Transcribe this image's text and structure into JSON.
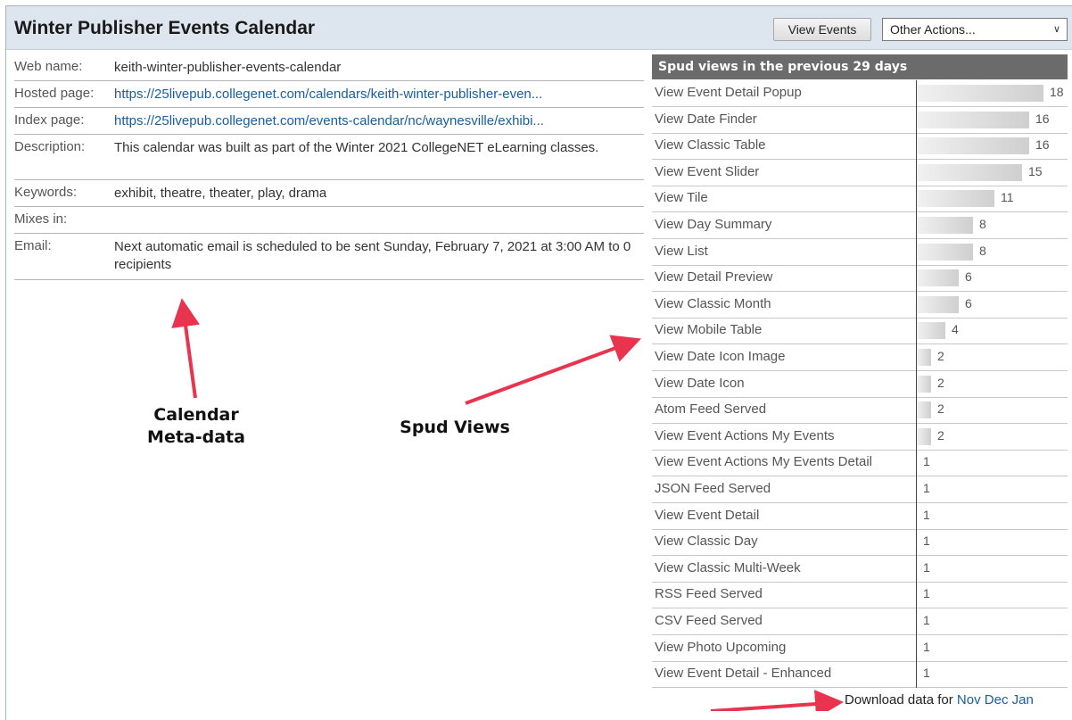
{
  "header": {
    "title": "Winter Publisher Events Calendar",
    "view_events_label": "View Events",
    "other_actions_label": "Other Actions..."
  },
  "meta": {
    "web_name": {
      "label": "Web name:",
      "value": "keith-winter-publisher-events-calendar"
    },
    "hosted_page": {
      "label": "Hosted page:",
      "value": "https://25livepub.collegenet.com/calendars/keith-winter-publisher-even..."
    },
    "index_page": {
      "label": "Index page:",
      "value": "https://25livepub.collegenet.com/events-calendar/nc/waynesville/exhibi..."
    },
    "description": {
      "label": "Description:",
      "value": "This calendar was built as part of the Winter 2021 CollegeNET eLearning classes."
    },
    "keywords": {
      "label": "Keywords:",
      "value": "exhibit, theatre, theater, play, drama"
    },
    "mixes_in": {
      "label": "Mixes in:",
      "value": ""
    },
    "email": {
      "label": "Email:",
      "value": "Next automatic email is scheduled to be sent Sunday, February 7, 2021 at 3:00 AM to 0 recipients"
    }
  },
  "stats": {
    "title": "Spud views in the previous 29 days",
    "max": 18,
    "rows": [
      {
        "label": "View Event Detail Popup",
        "value": "18",
        "count": 18
      },
      {
        "label": "View Date Finder",
        "value": "16",
        "count": 16
      },
      {
        "label": "View Classic Table",
        "value": "16",
        "count": 16
      },
      {
        "label": "View Event Slider",
        "value": "15",
        "count": 15
      },
      {
        "label": "View Tile",
        "value": "11",
        "count": 11
      },
      {
        "label": "View Day Summary",
        "value": "8",
        "count": 8
      },
      {
        "label": "View List",
        "value": "8",
        "count": 8
      },
      {
        "label": "View Detail Preview",
        "value": "6",
        "count": 6
      },
      {
        "label": "View Classic Month",
        "value": "6",
        "count": 6
      },
      {
        "label": "View Mobile Table",
        "value": "4",
        "count": 4
      },
      {
        "label": "View Date Icon Image",
        "value": "2",
        "count": 2
      },
      {
        "label": "View Date Icon",
        "value": "2",
        "count": 2
      },
      {
        "label": "Atom Feed Served",
        "value": "2",
        "count": 2
      },
      {
        "label": "View Event Actions My Events",
        "value": "2",
        "count": 2
      },
      {
        "label": "View Event Actions My Events Detail",
        "value": "1",
        "count": 1
      },
      {
        "label": "JSON Feed Served",
        "value": "1",
        "count": 1
      },
      {
        "label": "View Event Detail",
        "value": "1",
        "count": 1
      },
      {
        "label": "View Classic Day",
        "value": "1",
        "count": 1
      },
      {
        "label": "View Classic Multi-Week",
        "value": "1",
        "count": 1
      },
      {
        "label": "RSS Feed Served",
        "value": "1",
        "count": 1
      },
      {
        "label": "CSV Feed Served",
        "value": "1",
        "count": 1
      },
      {
        "label": "View Photo Upcoming",
        "value": "1",
        "count": 1
      },
      {
        "label": "View Event Detail - Enhanced",
        "value": "1",
        "count": 1
      }
    ]
  },
  "download": {
    "prefix": "Download data for",
    "links": [
      "Nov",
      "Dec",
      "Jan"
    ]
  },
  "annotations": {
    "calendar_meta_line1": "Calendar",
    "calendar_meta_line2": "Meta-data",
    "spud_views": "Spud Views",
    "arrow_color": "#e8344f"
  }
}
